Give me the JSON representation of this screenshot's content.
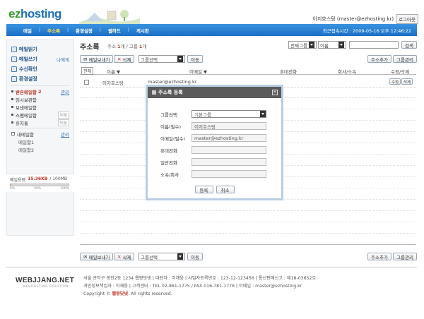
{
  "header": {
    "logo": "ezhosting",
    "account": "이지호스팅 (master@ezhosting.kr)",
    "logout": "로그아웃"
  },
  "nav": {
    "items": [
      "메일",
      "주소록",
      "환경설정",
      "웹하드",
      "게시판"
    ],
    "active_index": 1,
    "last_login": "최근접속시간 : 2009-05-16 오후 12:46:22"
  },
  "sidebar": {
    "read": "메일읽기",
    "write": "메일쓰기",
    "write_self": "나에게",
    "confirm": "수신확인",
    "settings": "환경설정",
    "folder_manage": "관리",
    "folders": [
      {
        "label": "받은메일함",
        "count": "2",
        "action": "관리"
      },
      {
        "label": "임시보관함",
        "action": ""
      },
      {
        "label": "보낸메일함",
        "action": ""
      },
      {
        "label": "스팸메일함",
        "action": "비움"
      },
      {
        "label": "휴지통",
        "action": "비움"
      }
    ],
    "my_box": "내메일함",
    "my_box_manage": "관리",
    "my_boxes": [
      "메일함1",
      "메일함2"
    ],
    "quota_label": "메일용량",
    "quota_used": "15.36KB",
    "quota_total": "/ 100MB",
    "quota_fraction": 0.01,
    "quota_ticks": [
      "0%",
      "50%",
      "100%"
    ]
  },
  "main": {
    "title": "주소록",
    "count_prefix": "주소",
    "count_addr": "1",
    "count_mid": "개 / 그룹",
    "count_group": "1",
    "count_suffix": "개",
    "search_scope": "전체그룹",
    "search_field": "이름",
    "search_value": "",
    "search_btn": "검색",
    "send_mail": "메일보내기",
    "delete": "삭제",
    "group_select": "그룹선택",
    "move": "이동",
    "add_address": "주소추가",
    "group_manage": "그룹관리",
    "columns": {
      "all": "전체",
      "name": "이름 ▼",
      "email": "이메일 ▼",
      "mobile": "휴대전화",
      "company": "회사/소속",
      "edit": "수정/삭제"
    },
    "row": {
      "name": "이지호스팅",
      "email": "master@ezhosting.kr",
      "edit": "수정",
      "del": "삭제"
    }
  },
  "modal": {
    "title": "주소록 등록",
    "group_label": "그룹선택",
    "group_value": "기본그룹",
    "name_label": "이름(필수)",
    "name_value": "이지호스팅",
    "email_label": "이메일(필수)",
    "email_value": "master@ezhosting.kr",
    "mobile_label": "휴대전화",
    "phone_label": "일반전화",
    "company_label": "소속/회사",
    "register": "등록",
    "cancel": "취소"
  },
  "footer": {
    "logo": "WEBJJANG.NET",
    "logo_sub": "WEBHOSTING SOLUTION",
    "line1": "서울 관악구 봉천2동 1234   웹짱닷넷   |   대표자 : 이채웅   |   사업자등록번호 : 123-12-123456   |   통신판매신고 : 제18-03652호",
    "line2": "개인정보책임자 : 이채웅   |   고객센터 : TEL.02-861-1775 / FAX.016-781-1776   |   이메일 : master@ezhosting.kr",
    "copy_pre": "Copyright ©",
    "copy_brand": "웹짱닷넷",
    "copy_post": ". All rights reserved."
  }
}
